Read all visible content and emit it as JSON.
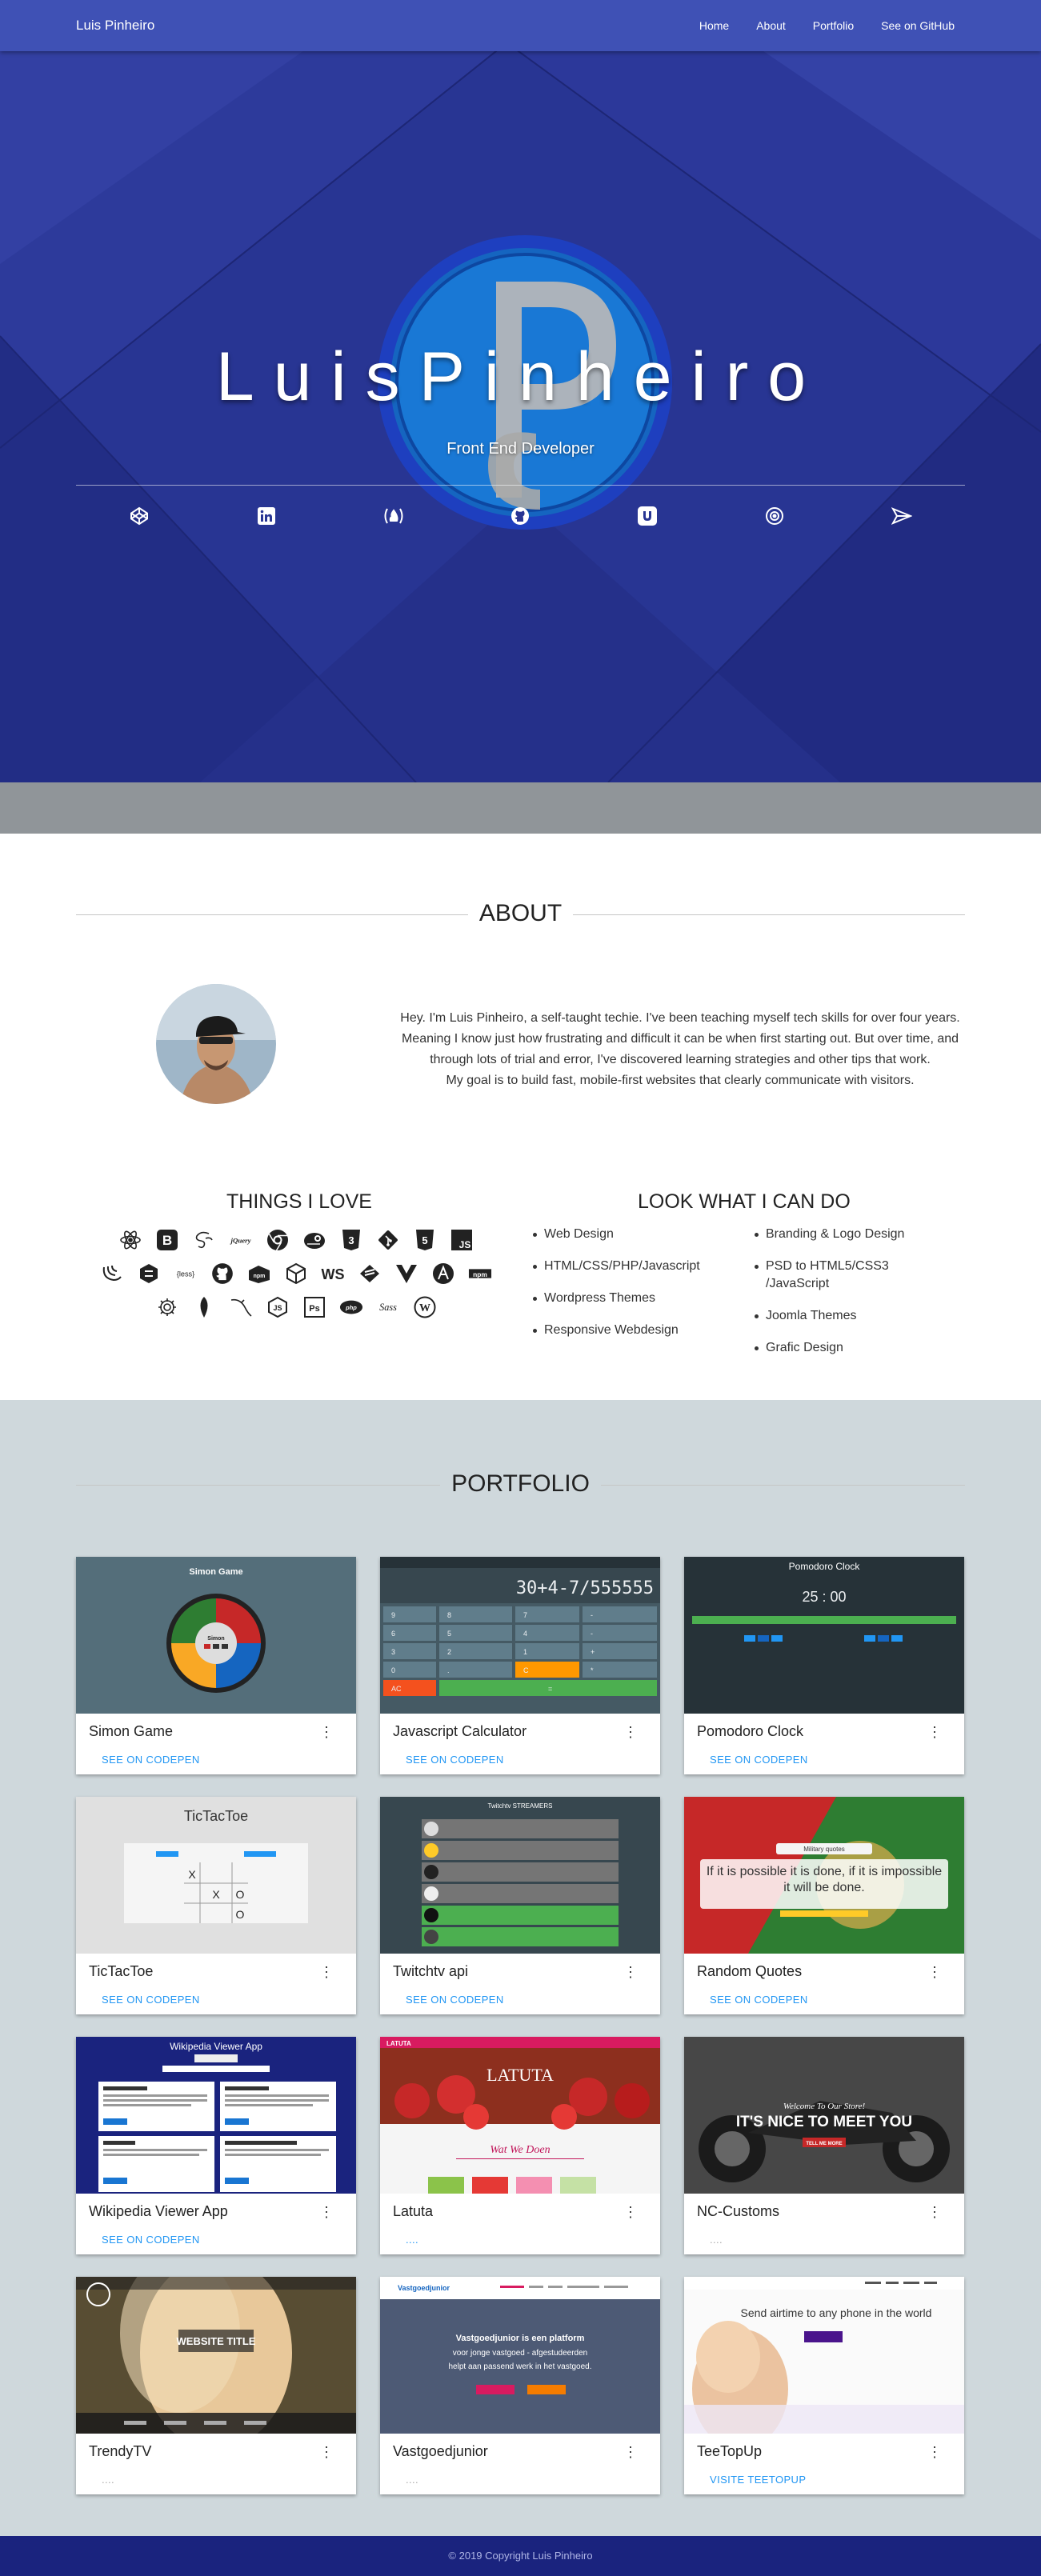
{
  "nav": {
    "brand": "Luis Pinheiro",
    "links": [
      "Home",
      "About",
      "Portfolio",
      "See on GitHub"
    ]
  },
  "hero": {
    "name": "LuisPinheiro",
    "subtitle": "Front End Developer",
    "social_icons": [
      "codepen-icon",
      "linkedin-icon",
      "freecodecamp-icon",
      "github-icon",
      "udemy-icon",
      "target-icon",
      "send-icon"
    ],
    "colors": {
      "nav": "#3f51b5",
      "hero": "#283593",
      "logo": "#1e88e5"
    }
  },
  "about": {
    "title": "ABOUT",
    "text_lines": [
      "Hey. I'm Luis Pinheiro, a self-taught techie. I've been teaching myself tech skills for over four years.",
      "Meaning I know just how frustrating and difficult it can be when first starting out. But over time, and",
      "through lots of trial and error, I've discovered learning strategies and other tips that work.",
      "My goal is to build fast, mobile-first websites that clearly communicate with visitors."
    ],
    "things_title": "THINGS I LOVE",
    "can_do_title": "LOOK WHAT I CAN DO",
    "can_do_left": [
      "Web Design",
      "HTML/CSS/PHP/Javascript",
      "Wordpress Themes",
      "Responsive Webdesign"
    ],
    "can_do_right": [
      "Branding & Logo Design",
      "PSD to HTML5/CSS3 /JavaScript",
      "Joomla Themes",
      "Grafic Design"
    ],
    "skill_rows": [
      [
        "react-icon",
        "bootstrap-icon",
        "sass-icon",
        "jquery-icon",
        "chrome-icon",
        "bower-icon",
        "css3-icon",
        "git-icon",
        "html5-icon",
        "js-icon"
      ],
      [
        "jquery-swirl-icon",
        "codepen-box-icon",
        "less-icon",
        "github-icon",
        "npm-icon",
        "cube-icon",
        "webstorm-icon",
        "sublime-icon",
        "vue-icon",
        "angular-icon",
        "npm-text-icon"
      ],
      [
        "gear-icon",
        "leaf-icon",
        "mysql-icon",
        "nodejs-icon",
        "photoshop-icon",
        "php-icon",
        "sass-text-icon",
        "wordpress-icon"
      ]
    ]
  },
  "portfolio": {
    "title": "PORTFOLIO",
    "link_label": "SEE ON CODEPEN",
    "cards": [
      {
        "title": "Simon Game",
        "link": "SEE ON CODEPEN"
      },
      {
        "title": "Javascript Calculator",
        "link": "SEE ON CODEPEN"
      },
      {
        "title": "Pomodoro Clock",
        "link": "SEE ON CODEPEN"
      },
      {
        "title": "TicTacToe",
        "link": "SEE ON CODEPEN"
      },
      {
        "title": "Twitchtv api",
        "link": "SEE ON CODEPEN"
      },
      {
        "title": "Random Quotes",
        "link": "SEE ON CODEPEN"
      },
      {
        "title": "Wikipedia Viewer App",
        "link": "SEE ON CODEPEN"
      },
      {
        "title": "Latuta",
        "link": "...."
      },
      {
        "title": "NC-Customs",
        "link": "...."
      },
      {
        "title": "TrendyTV",
        "link": "...."
      },
      {
        "title": "Vastgoedjunior",
        "link": "...."
      },
      {
        "title": "TeeTopUp",
        "link": "VISITE TEETOPUP"
      }
    ],
    "thumb_text": {
      "simon": "Simon Game",
      "simon_center": "Simon",
      "calc_display": "30+4-7/555555",
      "calc_keys": [
        "9",
        "8",
        "7",
        "-",
        "6",
        "5",
        "4",
        "-",
        "3",
        "2",
        "1",
        "+",
        "0",
        ".",
        "C",
        "*",
        "AC",
        "="
      ],
      "pomodoro_title": "Pomodoro Clock",
      "pomodoro_time": "25 : 00",
      "ttt_title": "TicTacToe",
      "ttt_cells": [
        "X",
        "",
        "",
        "",
        "X",
        "O",
        "",
        "",
        "O"
      ],
      "twitch_title": "Twitchtv STREAMERS",
      "quote_head": "Military quotes",
      "quote_text": "If it is possible it is done, if it is impossible it will be done.",
      "wiki_title": "Wikipedia Viewer App",
      "latuta_brand": "LATUTA",
      "latuta_sub": "Wat We Doen",
      "nc_small": "Welcome To Our Store!",
      "nc_big": "IT'S NICE TO MEET YOU",
      "nc_btn": "TELL ME MORE",
      "trendy_title": "WEBSITE TITLE",
      "vast_brand": "Vastgoedjunior",
      "vast_l1": "Vastgoedjunior is een platform",
      "vast_l2": "voor jonge vastgoed - afgestudeerden",
      "vast_l3": "helpt aan passend werk in het vastgoed.",
      "tee_text": "Send airtime to any phone in the world"
    }
  },
  "footer": {
    "text": "© 2019 Copyright Luis Pinheiro"
  }
}
